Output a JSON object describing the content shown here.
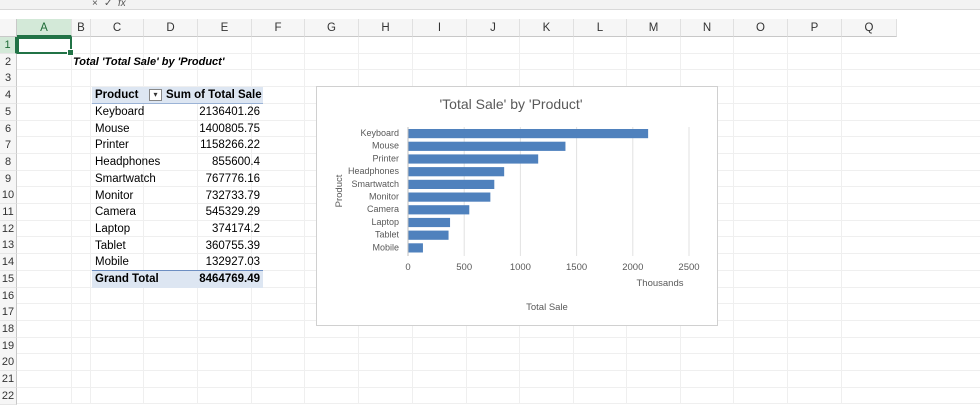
{
  "toolbar": {
    "fx_label": "fx",
    "cancel": "×",
    "confirm": "✓"
  },
  "columns": [
    "A",
    "B",
    "C",
    "D",
    "E",
    "F",
    "G",
    "H",
    "I",
    "J",
    "K",
    "L",
    "M",
    "N",
    "O",
    "P",
    "Q"
  ],
  "rows": [
    "1",
    "2",
    "3",
    "4",
    "5",
    "6",
    "7",
    "8",
    "9",
    "10",
    "11",
    "12",
    "13",
    "14",
    "15",
    "16",
    "17",
    "18",
    "19",
    "20",
    "21",
    "22"
  ],
  "sheet_title": "Total 'Total Sale' by 'Product'",
  "pivot": {
    "header_product": "Product",
    "header_value": "Sum of Total Sale",
    "rows": [
      {
        "product": "Keyboard",
        "value": "2136401.26"
      },
      {
        "product": "Mouse",
        "value": "1400805.75"
      },
      {
        "product": "Printer",
        "value": "1158266.22"
      },
      {
        "product": "Headphones",
        "value": "855600.4"
      },
      {
        "product": "Smartwatch",
        "value": "767776.16"
      },
      {
        "product": "Monitor",
        "value": "732733.79"
      },
      {
        "product": "Camera",
        "value": "545329.29"
      },
      {
        "product": "Laptop",
        "value": "374174.2"
      },
      {
        "product": "Tablet",
        "value": "360755.39"
      },
      {
        "product": "Mobile",
        "value": "132927.03"
      }
    ],
    "total_label": "Grand Total",
    "total_value": "8464769.49"
  },
  "chart_data": {
    "type": "bar",
    "orientation": "horizontal",
    "title": "'Total Sale' by 'Product'",
    "xlabel": "Total Sale",
    "ylabel": "Product",
    "display_unit": "Thousands",
    "categories": [
      "Keyboard",
      "Mouse",
      "Printer",
      "Headphones",
      "Smartwatch",
      "Monitor",
      "Camera",
      "Laptop",
      "Tablet",
      "Mobile"
    ],
    "values": [
      2136.40126,
      1400.80575,
      1158.26622,
      855.6004,
      767.77616,
      732.73379,
      545.32929,
      374.1742,
      360.75539,
      132.92703
    ],
    "xlim": [
      0,
      2500
    ],
    "xticks": [
      "0",
      "500",
      "1000",
      "1500",
      "2000",
      "2500"
    ],
    "grid": true,
    "bar_color": "#4f81bd"
  }
}
